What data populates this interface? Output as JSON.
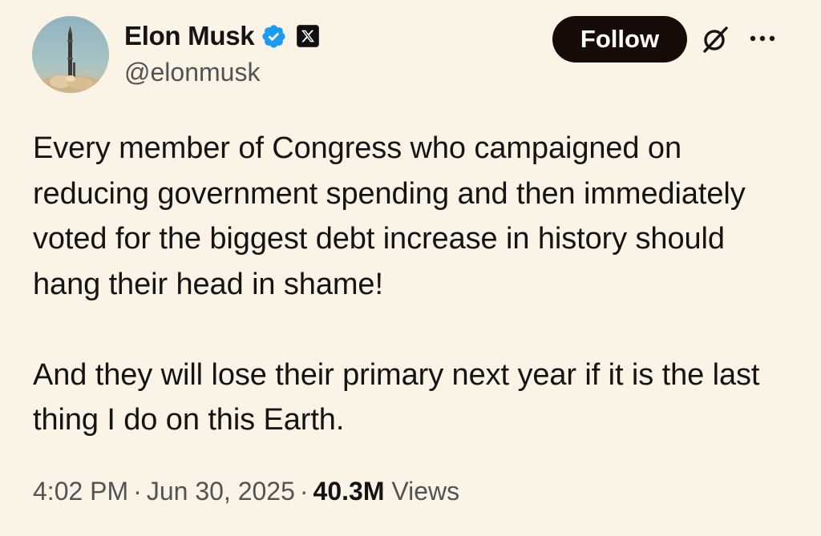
{
  "author": {
    "display_name": "Elon Musk",
    "handle": "@elonmusk",
    "verified_badge_color": "#1d9bf0",
    "affiliate_badge": "x-logo-icon"
  },
  "actions": {
    "follow_label": "Follow",
    "grok_icon": "grok-icon",
    "more_icon": "more-icon"
  },
  "tweet": {
    "paragraphs": [
      "Every member of Congress who campaigned on reducing government spending and then immediately voted for the biggest debt increase in history should hang their head in shame!",
      "And they will lose their primary next year if it is the last thing I do on this Earth."
    ]
  },
  "meta": {
    "time": "4:02 PM",
    "separator": "·",
    "date": "Jun 30, 2025",
    "views_count": "40.3M",
    "views_label": "Views"
  },
  "colors": {
    "background": "#fbf3e6",
    "text": "#141414",
    "secondary_text": "#535353",
    "follow_button_bg": "#170b07"
  }
}
